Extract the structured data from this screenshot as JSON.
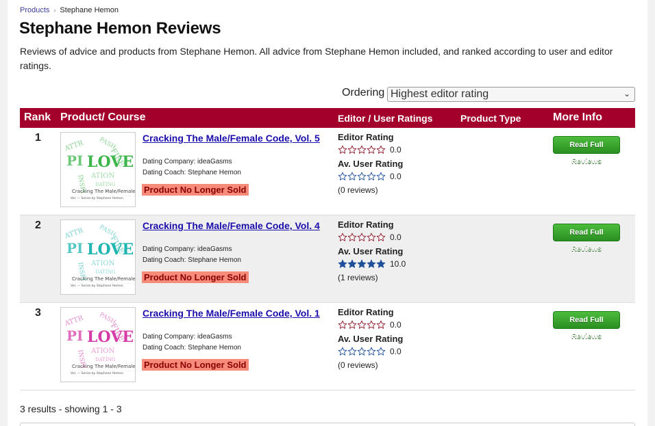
{
  "breadcrumb": {
    "parent": "Products",
    "current": "Stephane Hemon"
  },
  "page_title": "Stephane Hemon Reviews",
  "intro": "Reviews of advice and products from Stephane Hemon. All advice from Stephane Hemon included, and ranked according to user and editor ratings.",
  "ordering": {
    "label": "Ordering",
    "selected": "Highest editor rating"
  },
  "table_headers": {
    "rank": "Rank",
    "product": "Product/ Course",
    "ratings": "Editor / User Ratings",
    "type": "Product Type",
    "more": "More Info"
  },
  "rows": [
    {
      "rank": "1",
      "title": "Cracking The Male/Female Code, Vol. 5",
      "company": "Dating Company: ideaGasms",
      "coach": "Dating Coach: Stephane Hemon",
      "status": "Product No Longer Sold",
      "editor_label": "Editor Rating",
      "editor_score": "0.0",
      "editor_fraction": 0,
      "user_label": "Av. User Rating",
      "user_score": "0.0",
      "user_fraction": 0,
      "reviews": "(0 reviews)",
      "button": "Read Full Reviews",
      "thumb_caption": "Cracking The Male/Female Code",
      "thumb_color": "#3bb54a"
    },
    {
      "rank": "2",
      "title": "Cracking The Male/Female Code, Vol. 4",
      "company": "Dating Company: ideaGasms",
      "coach": "Dating Coach: Stephane Hemon",
      "status": "Product No Longer Sold",
      "editor_label": "Editor Rating",
      "editor_score": "0.0",
      "editor_fraction": 0,
      "user_label": "Av. User Rating",
      "user_score": "10.0",
      "user_fraction": 1,
      "reviews": "(1 reviews)",
      "button": "Read Full Reviews",
      "thumb_caption": "Cracking The Male/Female Code",
      "thumb_color": "#1fb5b0"
    },
    {
      "rank": "3",
      "title": "Cracking The Male/Female Code, Vol. 1",
      "company": "Dating Company: ideaGasms",
      "coach": "Dating Coach: Stephane Hemon",
      "status": "Product No Longer Sold",
      "editor_label": "Editor Rating",
      "editor_score": "0.0",
      "editor_fraction": 0,
      "user_label": "Av. User Rating",
      "user_score": "0.0",
      "user_fraction": 0,
      "reviews": "(0 reviews)",
      "button": "Read Full Reviews",
      "thumb_caption": "Cracking The Male/Female Code",
      "thumb_color": "#d63ca8"
    }
  ],
  "results_text": "3 results - showing 1 - 3",
  "colors": {
    "header_bg": "#a3002b",
    "editor_star": "#8b1a2b",
    "user_star": "#1f4e9a",
    "status_bg": "#f58b78",
    "button_green": "#3aa52e"
  },
  "icons": {
    "star": "star-icon",
    "chevron": "chevron-down-icon"
  }
}
